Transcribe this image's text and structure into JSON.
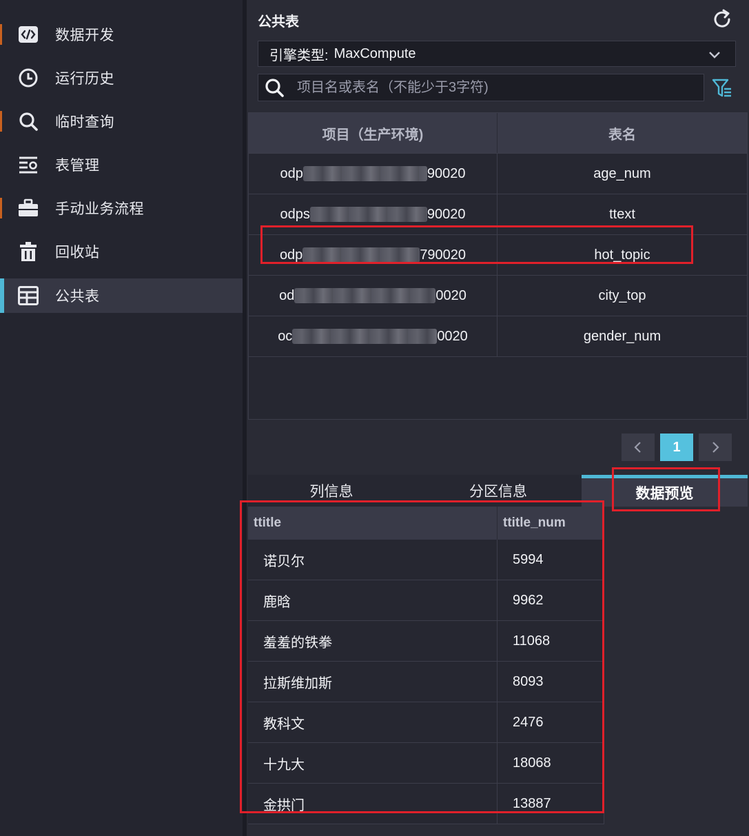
{
  "sidebar": {
    "items": [
      {
        "label": "数据开发",
        "icon": "code-icon"
      },
      {
        "label": "运行历史",
        "icon": "clock-icon"
      },
      {
        "label": "临时查询",
        "icon": "search-icon"
      },
      {
        "label": "表管理",
        "icon": "table-manage-icon"
      },
      {
        "label": "手动业务流程",
        "icon": "briefcase-icon"
      },
      {
        "label": "回收站",
        "icon": "trash-icon"
      },
      {
        "label": "公共表",
        "icon": "grid-table-icon"
      }
    ],
    "active_index": 6
  },
  "panel": {
    "title": "公共表",
    "engine_label": "引擎类型:",
    "engine_value": "MaxCompute",
    "search_placeholder": "项目名或表名（不能少于3字符)"
  },
  "tables_list": {
    "headers": [
      "项目（生产环境)",
      "表名"
    ],
    "rows": [
      {
        "project_prefix": "odp",
        "project_suffix": "90020",
        "table": "age_num"
      },
      {
        "project_prefix": "odps",
        "project_suffix": "90020",
        "table": "ttext"
      },
      {
        "project_prefix": "odp",
        "project_suffix": "790020",
        "table": "hot_topic"
      },
      {
        "project_prefix": "od",
        "project_suffix": "0020",
        "table": "city_top"
      },
      {
        "project_prefix": "oc",
        "project_suffix": "0020",
        "table": "gender_num"
      }
    ]
  },
  "pager": {
    "prev": "‹",
    "current": "1",
    "next": "›"
  },
  "tabs": {
    "columns": "列信息",
    "partitions": "分区信息",
    "preview": "数据预览"
  },
  "preview": {
    "headers": [
      "ttitle",
      "ttitle_num"
    ],
    "rows": [
      [
        "诺贝尔",
        "5994"
      ],
      [
        "鹿晗",
        "9962"
      ],
      [
        "羞羞的铁拳",
        "11068"
      ],
      [
        "拉斯维加斯",
        "8093"
      ],
      [
        "教科文",
        "2476"
      ],
      [
        "十九大",
        "18068"
      ],
      [
        "金拱门",
        "13887"
      ]
    ]
  },
  "colors": {
    "accent": "#4fb8d6",
    "highlight": "#e0202a",
    "sidebar_marker": "#c9611f"
  }
}
